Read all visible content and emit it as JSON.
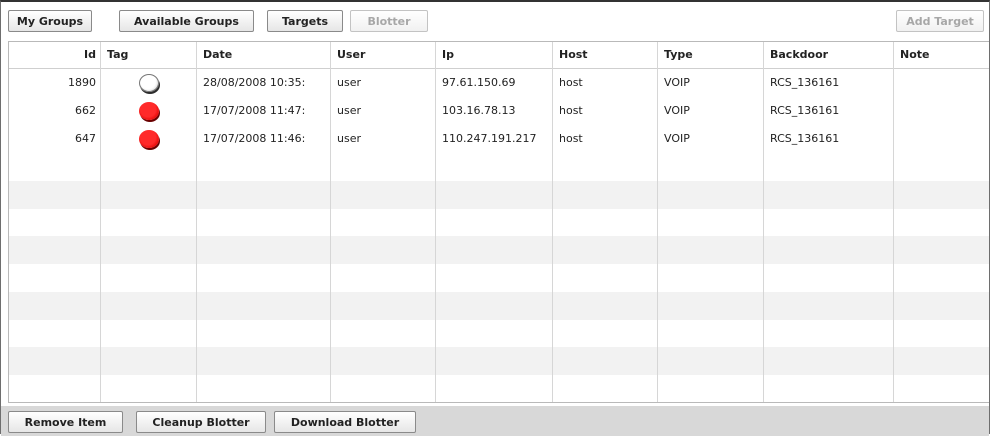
{
  "toolbar": {
    "buttons": [
      {
        "label": "My Groups",
        "enabled": true
      },
      {
        "label": "Available Groups",
        "enabled": true
      },
      {
        "label": "Targets",
        "enabled": true
      },
      {
        "label": "Blotter",
        "enabled": false
      }
    ],
    "add_target_label": "Add Target"
  },
  "table": {
    "columns": [
      "Id",
      "Tag",
      "Date",
      "User",
      "Ip",
      "Host",
      "Type",
      "Backdoor",
      "Note"
    ],
    "rows": [
      {
        "id": "1890",
        "tag": "white",
        "date": "28/08/2008 10:35:",
        "user": "user",
        "ip": "97.61.150.69",
        "host": "host",
        "type": "VOIP",
        "backdoor": "RCS_136161",
        "note": ""
      },
      {
        "id": "662",
        "tag": "red",
        "date": "17/07/2008 11:47:",
        "user": "user",
        "ip": "103.16.78.13",
        "host": "host",
        "type": "VOIP",
        "backdoor": "RCS_136161",
        "note": ""
      },
      {
        "id": "647",
        "tag": "red",
        "date": "17/07/2008 11:46:",
        "user": "user",
        "ip": "110.247.191.217",
        "host": "host",
        "type": "VOIP",
        "backdoor": "RCS_136161",
        "note": ""
      }
    ]
  },
  "bottom": {
    "buttons": [
      "Remove Item",
      "Cleanup Blotter",
      "Download Blotter"
    ]
  },
  "colors": {
    "tag_white": "#ffffff",
    "tag_red": "#ff1a1a"
  }
}
